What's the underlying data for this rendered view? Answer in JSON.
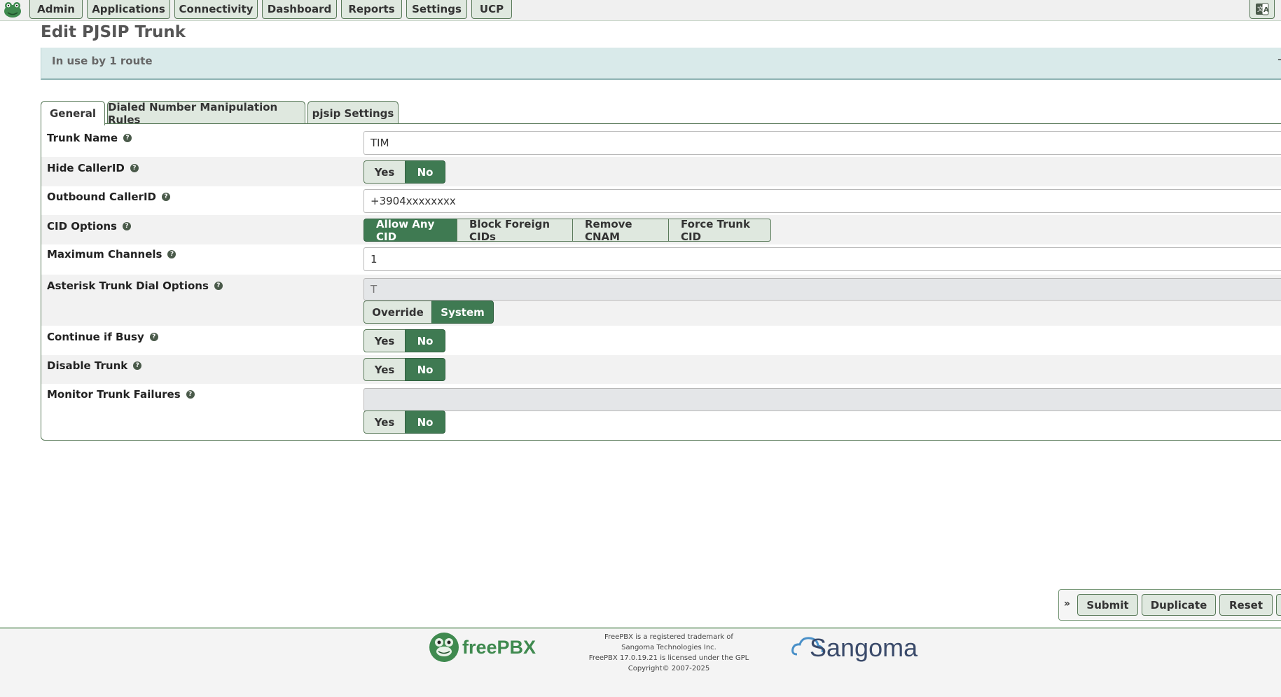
{
  "nav": {
    "items": [
      "Admin",
      "Applications",
      "Connectivity",
      "Dashboard",
      "Reports",
      "Settings",
      "UCP"
    ]
  },
  "page": {
    "title": "Edit PJSIP Trunk",
    "banner": "In use by 1 route",
    "banner_close": "-"
  },
  "tabs": [
    "General",
    "Dialed Number Manipulation Rules",
    "pjsip Settings"
  ],
  "form": {
    "trunk_name": {
      "label": "Trunk Name",
      "value": "TIM"
    },
    "hide_callerid": {
      "label": "Hide CallerID",
      "yes": "Yes",
      "no": "No",
      "selected": "No"
    },
    "outbound_callerid": {
      "label": "Outbound CallerID",
      "value": "+3904xxxxxxxx"
    },
    "cid_options": {
      "label": "CID Options",
      "options": [
        "Allow Any CID",
        "Block Foreign CIDs",
        "Remove CNAM",
        "Force Trunk CID"
      ],
      "selected": "Allow Any CID"
    },
    "max_channels": {
      "label": "Maximum Channels",
      "value": "1"
    },
    "dial_options": {
      "label": "Asterisk Trunk Dial Options",
      "value": "T",
      "override": "Override",
      "system": "System",
      "selected": "System"
    },
    "continue_if_busy": {
      "label": "Continue if Busy",
      "yes": "Yes",
      "no": "No",
      "selected": "No"
    },
    "disable_trunk": {
      "label": "Disable Trunk",
      "yes": "Yes",
      "no": "No",
      "selected": "No"
    },
    "monitor_failures": {
      "label": "Monitor Trunk Failures",
      "value": "",
      "yes": "Yes",
      "no": "No",
      "selected": "No"
    }
  },
  "actions": {
    "toggle": "»",
    "submit": "Submit",
    "duplicate": "Duplicate",
    "reset": "Reset"
  },
  "footer": {
    "freepbx": "freePBX",
    "line1": "FreePBX is a registered trademark of",
    "line2": "Sangoma Technologies Inc.",
    "line3": "FreePBX 17.0.19.21 is licensed under the GPL",
    "line4": "Copyright© 2007-2025",
    "sangoma": "Sangoma"
  },
  "colors": {
    "accent": "#3f7a52",
    "button_bg": "#dfe8df",
    "banner_bg": "#d9eaea"
  }
}
